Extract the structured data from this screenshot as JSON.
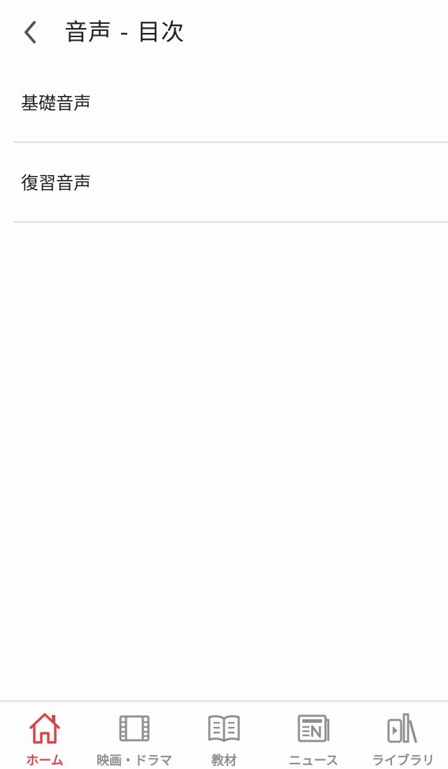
{
  "header": {
    "title": "音声 - 目次",
    "back_icon": "chevron-left-icon"
  },
  "list": {
    "items": [
      {
        "label": "基礎音声"
      },
      {
        "label": "復習音声"
      }
    ]
  },
  "tabbar": {
    "active_color": "#d7454c",
    "inactive_color": "#8f8f8f",
    "tabs": [
      {
        "label": "ホーム",
        "icon": "home-icon",
        "active": true
      },
      {
        "label": "映画・ドラマ",
        "icon": "film-icon",
        "active": false
      },
      {
        "label": "教材",
        "icon": "book-icon",
        "active": false
      },
      {
        "label": "ニュース",
        "icon": "newspaper-icon",
        "active": false
      },
      {
        "label": "ライブラリ",
        "icon": "library-icon",
        "active": false
      }
    ]
  }
}
